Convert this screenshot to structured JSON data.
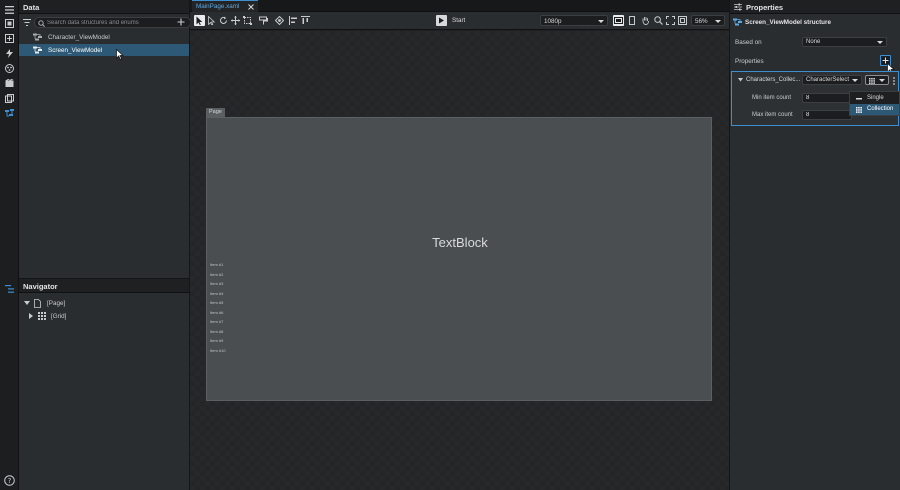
{
  "data_panel": {
    "title": "Data",
    "search_placeholder": "Search data structures and enums",
    "items": [
      {
        "label": "Character_ViewModel"
      },
      {
        "label": "Screen_ViewModel"
      }
    ]
  },
  "navigator": {
    "title": "Navigator",
    "items": [
      {
        "label": "[Page]"
      },
      {
        "label": "[Grid]"
      }
    ]
  },
  "document_tab": {
    "label": "MainPage.xaml"
  },
  "toolbar": {
    "start_label": "Start",
    "resolution": "1080p",
    "zoom": "56%"
  },
  "canvas": {
    "page_tag": "Page",
    "textblock": "TextBlock",
    "items": [
      "Item #1",
      "Item #2",
      "Item #3",
      "Item #4",
      "Item #5",
      "Item #6",
      "Item #7",
      "Item #8",
      "Item #9",
      "Item #10"
    ]
  },
  "properties": {
    "title": "Properties",
    "structure_title": "Screen_ViewModel structure",
    "based_on_label": "Based on",
    "based_on_value": "None",
    "properties_label": "Properties",
    "property": {
      "name": "Characters_Collec...",
      "type": "CharacterSelect",
      "min_label": "Min item count",
      "min_value": "8",
      "max_label": "Max item count",
      "max_value": "8"
    },
    "menu": [
      {
        "label": "Single"
      },
      {
        "label": "Collection"
      }
    ]
  },
  "colors": {
    "accent": "#3d8fd1",
    "selection": "#2d5977"
  }
}
